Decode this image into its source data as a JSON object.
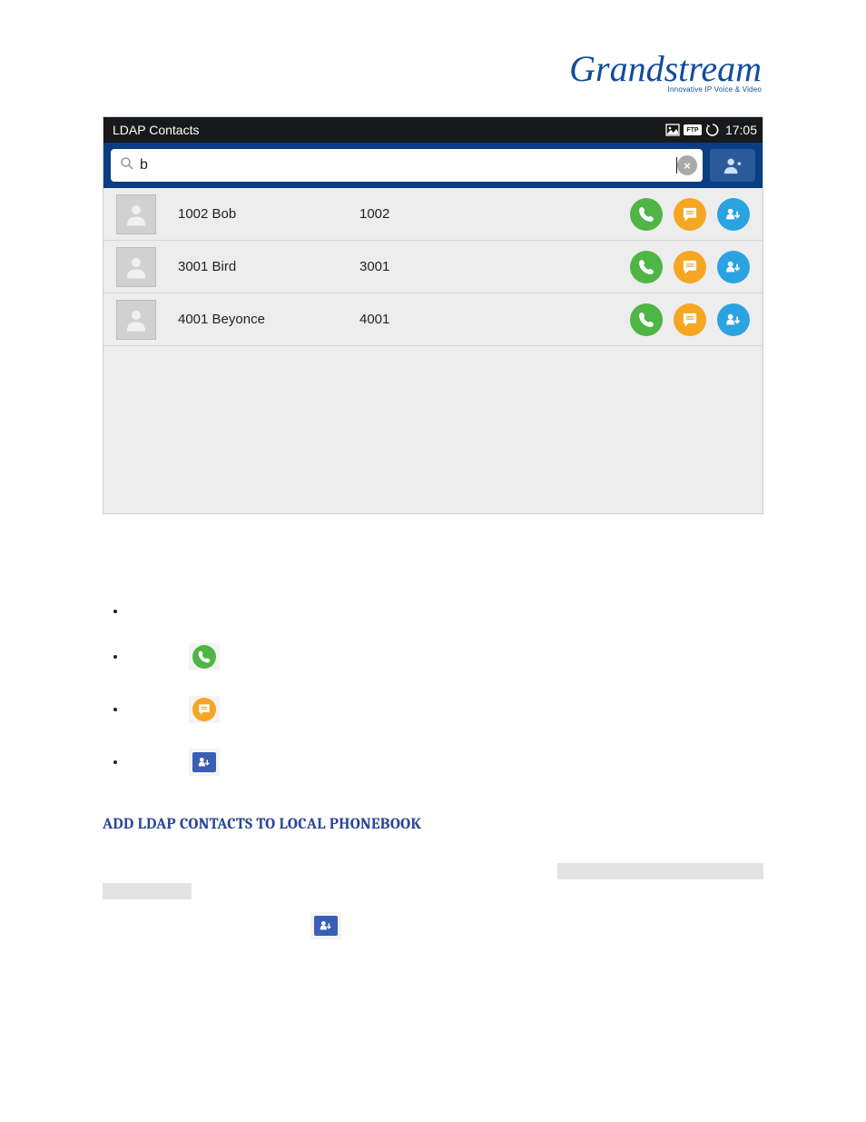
{
  "logo": {
    "brand": "Grandstream",
    "tag": "Innovative IP Voice & Video"
  },
  "statusbar": {
    "title": "LDAP Contacts",
    "ftp_label": "FTP",
    "time": "17:05"
  },
  "search": {
    "value": "b"
  },
  "icons": {
    "clear": "×",
    "call": "call-icon",
    "message": "message-icon",
    "add_to_phonebook": "add-contact-icon",
    "add_user": "add-user-icon",
    "search": "search-icon",
    "image": "image-icon",
    "refresh": "refresh-icon"
  },
  "contacts": [
    {
      "name": "1002 Bob",
      "number": "1002"
    },
    {
      "name": "3001 Bird",
      "number": "3001"
    },
    {
      "name": "4001 Beyonce",
      "number": "4001"
    }
  ],
  "section_heading": "ADD LDAP CONTACTS TO LOCAL PHONEBOOK"
}
